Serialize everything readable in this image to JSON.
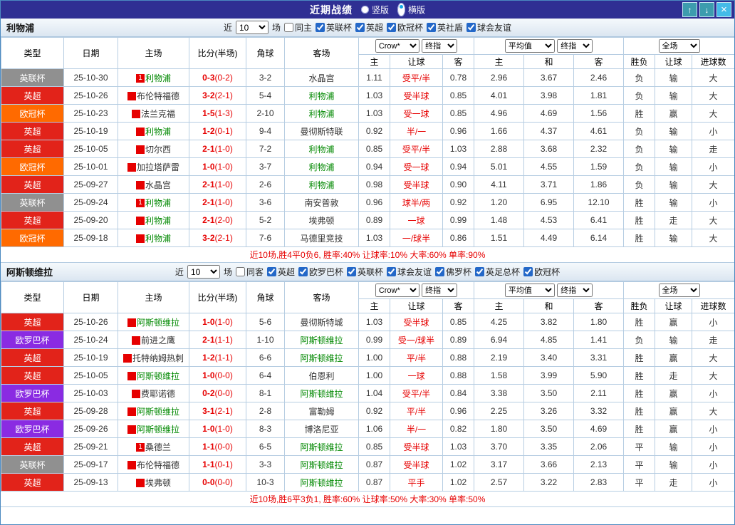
{
  "titlebar": {
    "title": "近期战绩",
    "radios": [
      {
        "label": "竖版",
        "selected": false
      },
      {
        "label": "横版",
        "selected": true
      }
    ],
    "buttons": {
      "up": "↑",
      "down": "↓",
      "close": "×"
    }
  },
  "league_colors": {
    "英超": "#e2231a",
    "英联杯": "#909090",
    "欧冠杯": "#ff6a00",
    "欧罗巴杯": "#8a2be2"
  },
  "colors": {
    "win": "#e60000",
    "lose": "#0000e0",
    "draw": "#008800",
    "team_name": "#008800",
    "title_bg": "#2f2f93"
  },
  "table_header": {
    "cols": [
      "类型",
      "日期",
      "主场",
      "比分(半场)",
      "角球",
      "客场"
    ],
    "odds_group": {
      "source": "Crow*",
      "final": "终指",
      "cols": [
        "主",
        "让球",
        "客"
      ]
    },
    "avg_group": {
      "source": "平均值",
      "final": "终指",
      "cols": [
        "主",
        "和",
        "客"
      ]
    },
    "result_group": {
      "scope": "全场",
      "cols": [
        "胜负",
        "让球",
        "进球数"
      ]
    }
  },
  "sections": [
    {
      "team": "利物浦",
      "filter": {
        "prefix": "近",
        "count": "10",
        "suffix": "场",
        "same": {
          "label": "同主",
          "checked": false
        },
        "leagues": [
          {
            "label": "英联杯",
            "checked": true
          },
          {
            "label": "英超",
            "checked": true
          },
          {
            "label": "欧冠杯",
            "checked": true
          },
          {
            "label": "英社盾",
            "checked": true
          },
          {
            "label": "球会友谊",
            "checked": true
          }
        ]
      },
      "rows": [
        {
          "league": "英联杯",
          "date": "25-10-30",
          "home": "利物浦",
          "home_team": true,
          "home_badge": "1",
          "away": "水晶宫",
          "away_team": false,
          "score": "0-3",
          "half": "(0-2)",
          "corners": "3-2",
          "odds": [
            "1.11",
            "受平/半",
            "0.78"
          ],
          "avg": [
            "2.96",
            "3.67",
            "2.46"
          ],
          "results": [
            {
              "t": "负",
              "c": "blue"
            },
            {
              "t": "输",
              "c": "blue"
            },
            {
              "t": "大",
              "c": "red"
            }
          ]
        },
        {
          "league": "英超",
          "date": "25-10-26",
          "home": "布伦特福德",
          "home_team": false,
          "away": "利物浦",
          "away_team": true,
          "score": "3-2",
          "half": "(2-1)",
          "corners": "5-4",
          "odds": [
            "1.03",
            "受半球",
            "0.85"
          ],
          "avg": [
            "4.01",
            "3.98",
            "1.81"
          ],
          "results": [
            {
              "t": "负",
              "c": "blue"
            },
            {
              "t": "输",
              "c": "blue"
            },
            {
              "t": "大",
              "c": "red"
            }
          ]
        },
        {
          "league": "欧冠杯",
          "date": "25-10-23",
          "home": "法兰克福",
          "home_team": false,
          "away": "利物浦",
          "away_team": true,
          "score": "1-5",
          "half": "(1-3)",
          "corners": "2-10",
          "odds": [
            "1.03",
            "受一球",
            "0.85"
          ],
          "avg": [
            "4.96",
            "4.69",
            "1.56"
          ],
          "results": [
            {
              "t": "胜",
              "c": "red"
            },
            {
              "t": "赢",
              "c": "red"
            },
            {
              "t": "大",
              "c": "red"
            }
          ]
        },
        {
          "league": "英超",
          "date": "25-10-19",
          "home": "利物浦",
          "home_team": true,
          "away": "曼彻斯特联",
          "away_team": false,
          "score": "1-2",
          "half": "(0-1)",
          "corners": "9-4",
          "odds": [
            "0.92",
            "半/一",
            "0.96"
          ],
          "avg": [
            "1.66",
            "4.37",
            "4.61"
          ],
          "results": [
            {
              "t": "负",
              "c": "blue"
            },
            {
              "t": "输",
              "c": "blue"
            },
            {
              "t": "小",
              "c": "blue"
            }
          ]
        },
        {
          "league": "英超",
          "date": "25-10-05",
          "home": "切尔西",
          "home_team": false,
          "away": "利物浦",
          "away_team": true,
          "score": "2-1",
          "half": "(1-0)",
          "corners": "7-2",
          "odds": [
            "0.85",
            "受平/半",
            "1.03"
          ],
          "avg": [
            "2.88",
            "3.68",
            "2.32"
          ],
          "results": [
            {
              "t": "负",
              "c": "blue"
            },
            {
              "t": "输",
              "c": "blue"
            },
            {
              "t": "走",
              "c": "green"
            }
          ]
        },
        {
          "league": "欧冠杯",
          "date": "25-10-01",
          "home": "加拉塔萨雷",
          "home_team": false,
          "away": "利物浦",
          "away_team": true,
          "score": "1-0",
          "half": "(1-0)",
          "corners": "3-7",
          "odds": [
            "0.94",
            "受一球",
            "0.94"
          ],
          "avg": [
            "5.01",
            "4.55",
            "1.59"
          ],
          "results": [
            {
              "t": "负",
              "c": "blue"
            },
            {
              "t": "输",
              "c": "blue"
            },
            {
              "t": "小",
              "c": "blue"
            }
          ]
        },
        {
          "league": "英超",
          "date": "25-09-27",
          "home": "水晶宫",
          "home_team": false,
          "away": "利物浦",
          "away_team": true,
          "score": "2-1",
          "half": "(1-0)",
          "corners": "2-6",
          "odds": [
            "0.98",
            "受半球",
            "0.90"
          ],
          "avg": [
            "4.11",
            "3.71",
            "1.86"
          ],
          "results": [
            {
              "t": "负",
              "c": "blue"
            },
            {
              "t": "输",
              "c": "blue"
            },
            {
              "t": "大",
              "c": "red"
            }
          ]
        },
        {
          "league": "英联杯",
          "date": "25-09-24",
          "home": "利物浦",
          "home_team": true,
          "home_badge": "1",
          "away": "南安普敦",
          "away_team": false,
          "score": "2-1",
          "half": "(1-0)",
          "corners": "3-6",
          "odds": [
            "0.96",
            "球半/两",
            "0.92"
          ],
          "avg": [
            "1.20",
            "6.95",
            "12.10"
          ],
          "results": [
            {
              "t": "胜",
              "c": "red"
            },
            {
              "t": "输",
              "c": "blue"
            },
            {
              "t": "小",
              "c": "blue"
            }
          ]
        },
        {
          "league": "英超",
          "date": "25-09-20",
          "home": "利物浦",
          "home_team": true,
          "away": "埃弗顿",
          "away_team": false,
          "score": "2-1",
          "half": "(2-0)",
          "corners": "5-2",
          "odds": [
            "0.89",
            "一球",
            "0.99"
          ],
          "avg": [
            "1.48",
            "4.53",
            "6.41"
          ],
          "results": [
            {
              "t": "胜",
              "c": "red"
            },
            {
              "t": "走",
              "c": "green"
            },
            {
              "t": "大",
              "c": "red"
            }
          ]
        },
        {
          "league": "欧冠杯",
          "date": "25-09-18",
          "home": "利物浦",
          "home_team": true,
          "away": "马德里竞技",
          "away_team": false,
          "score": "3-2",
          "half": "(2-1)",
          "corners": "7-6",
          "odds": [
            "1.03",
            "一/球半",
            "0.86"
          ],
          "avg": [
            "1.51",
            "4.49",
            "6.14"
          ],
          "results": [
            {
              "t": "胜",
              "c": "red"
            },
            {
              "t": "输",
              "c": "blue"
            },
            {
              "t": "大",
              "c": "red"
            }
          ]
        }
      ],
      "summary": "近10场,胜4平0负6, 胜率:40% 让球率:10% 大率:60% 单率:90%"
    },
    {
      "team": "阿斯顿维拉",
      "filter": {
        "prefix": "近",
        "count": "10",
        "suffix": "场",
        "same": {
          "label": "同客",
          "checked": false
        },
        "leagues": [
          {
            "label": "英超",
            "checked": true
          },
          {
            "label": "欧罗巴杯",
            "checked": true
          },
          {
            "label": "英联杯",
            "checked": true
          },
          {
            "label": "球会友谊",
            "checked": true
          },
          {
            "label": "佛罗杯",
            "checked": true
          },
          {
            "label": "英足总杯",
            "checked": true
          },
          {
            "label": "欧冠杯",
            "checked": true
          }
        ]
      },
      "rows": [
        {
          "league": "英超",
          "date": "25-10-26",
          "home": "阿斯顿维拉",
          "home_team": true,
          "away": "曼彻斯特城",
          "away_team": false,
          "score": "1-0",
          "half": "(1-0)",
          "corners": "5-6",
          "odds": [
            "1.03",
            "受半球",
            "0.85"
          ],
          "avg": [
            "4.25",
            "3.82",
            "1.80"
          ],
          "results": [
            {
              "t": "胜",
              "c": "red"
            },
            {
              "t": "赢",
              "c": "red"
            },
            {
              "t": "小",
              "c": "blue"
            }
          ]
        },
        {
          "league": "欧罗巴杯",
          "date": "25-10-24",
          "home": "前进之鹰",
          "home_team": false,
          "away": "阿斯顿维拉",
          "away_team": true,
          "score": "2-1",
          "half": "(1-1)",
          "corners": "1-10",
          "odds": [
            "0.99",
            "受一/球半",
            "0.89"
          ],
          "avg": [
            "6.94",
            "4.85",
            "1.41"
          ],
          "results": [
            {
              "t": "负",
              "c": "blue"
            },
            {
              "t": "输",
              "c": "blue"
            },
            {
              "t": "走",
              "c": "green"
            }
          ]
        },
        {
          "league": "英超",
          "date": "25-10-19",
          "home": "托特纳姆热刺",
          "home_team": false,
          "away": "阿斯顿维拉",
          "away_team": true,
          "score": "1-2",
          "half": "(1-1)",
          "corners": "6-6",
          "odds": [
            "1.00",
            "平/半",
            "0.88"
          ],
          "avg": [
            "2.19",
            "3.40",
            "3.31"
          ],
          "results": [
            {
              "t": "胜",
              "c": "red"
            },
            {
              "t": "赢",
              "c": "red"
            },
            {
              "t": "大",
              "c": "red"
            }
          ]
        },
        {
          "league": "英超",
          "date": "25-10-05",
          "home": "阿斯顿维拉",
          "home_team": true,
          "away": "伯恩利",
          "away_team": false,
          "score": "1-0",
          "half": "(0-0)",
          "corners": "6-4",
          "odds": [
            "1.00",
            "一球",
            "0.88"
          ],
          "avg": [
            "1.58",
            "3.99",
            "5.90"
          ],
          "results": [
            {
              "t": "胜",
              "c": "red"
            },
            {
              "t": "走",
              "c": "green"
            },
            {
              "t": "大",
              "c": "red"
            }
          ]
        },
        {
          "league": "欧罗巴杯",
          "date": "25-10-03",
          "home": "费耶诺德",
          "home_team": false,
          "away": "阿斯顿维拉",
          "away_team": true,
          "score": "0-2",
          "half": "(0-0)",
          "corners": "8-1",
          "odds": [
            "1.04",
            "受平/半",
            "0.84"
          ],
          "avg": [
            "3.38",
            "3.50",
            "2.11"
          ],
          "results": [
            {
              "t": "胜",
              "c": "red"
            },
            {
              "t": "赢",
              "c": "red"
            },
            {
              "t": "小",
              "c": "blue"
            }
          ]
        },
        {
          "league": "英超",
          "date": "25-09-28",
          "home": "阿斯顿维拉",
          "home_team": true,
          "away": "富勒姆",
          "away_team": false,
          "score": "3-1",
          "half": "(2-1)",
          "corners": "2-8",
          "odds": [
            "0.92",
            "平/半",
            "0.96"
          ],
          "avg": [
            "2.25",
            "3.26",
            "3.32"
          ],
          "results": [
            {
              "t": "胜",
              "c": "red"
            },
            {
              "t": "赢",
              "c": "red"
            },
            {
              "t": "大",
              "c": "red"
            }
          ]
        },
        {
          "league": "欧罗巴杯",
          "date": "25-09-26",
          "home": "阿斯顿维拉",
          "home_team": true,
          "away": "博洛尼亚",
          "away_team": false,
          "score": "1-0",
          "half": "(1-0)",
          "corners": "8-3",
          "odds": [
            "1.06",
            "半/一",
            "0.82"
          ],
          "avg": [
            "1.80",
            "3.50",
            "4.69"
          ],
          "results": [
            {
              "t": "胜",
              "c": "red"
            },
            {
              "t": "赢",
              "c": "red"
            },
            {
              "t": "小",
              "c": "blue"
            }
          ]
        },
        {
          "league": "英超",
          "date": "25-09-21",
          "home": "桑德兰",
          "home_team": false,
          "home_badge": "1",
          "away": "阿斯顿维拉",
          "away_team": true,
          "score": "1-1",
          "half": "(0-0)",
          "corners": "6-5",
          "odds": [
            "0.85",
            "受半球",
            "1.03"
          ],
          "avg": [
            "3.70",
            "3.35",
            "2.06"
          ],
          "results": [
            {
              "t": "平",
              "c": "green"
            },
            {
              "t": "输",
              "c": "blue"
            },
            {
              "t": "小",
              "c": "blue"
            }
          ]
        },
        {
          "league": "英联杯",
          "date": "25-09-17",
          "home": "布伦特福德",
          "home_team": false,
          "away": "阿斯顿维拉",
          "away_team": true,
          "score": "1-1",
          "half": "(0-1)",
          "corners": "3-3",
          "odds": [
            "0.87",
            "受半球",
            "1.02"
          ],
          "avg": [
            "3.17",
            "3.66",
            "2.13"
          ],
          "results": [
            {
              "t": "平",
              "c": "green"
            },
            {
              "t": "输",
              "c": "blue"
            },
            {
              "t": "小",
              "c": "blue"
            }
          ]
        },
        {
          "league": "英超",
          "date": "25-09-13",
          "home": "埃弗顿",
          "home_team": false,
          "away": "阿斯顿维拉",
          "away_team": true,
          "score": "0-0",
          "half": "(0-0)",
          "corners": "10-3",
          "odds": [
            "0.87",
            "平手",
            "1.02"
          ],
          "avg": [
            "2.57",
            "3.22",
            "2.83"
          ],
          "results": [
            {
              "t": "平",
              "c": "green"
            },
            {
              "t": "走",
              "c": "green"
            },
            {
              "t": "小",
              "c": "blue"
            }
          ]
        }
      ],
      "summary": "近10场,胜6平3负1, 胜率:60% 让球率:50% 大率:30% 单率:50%"
    }
  ]
}
